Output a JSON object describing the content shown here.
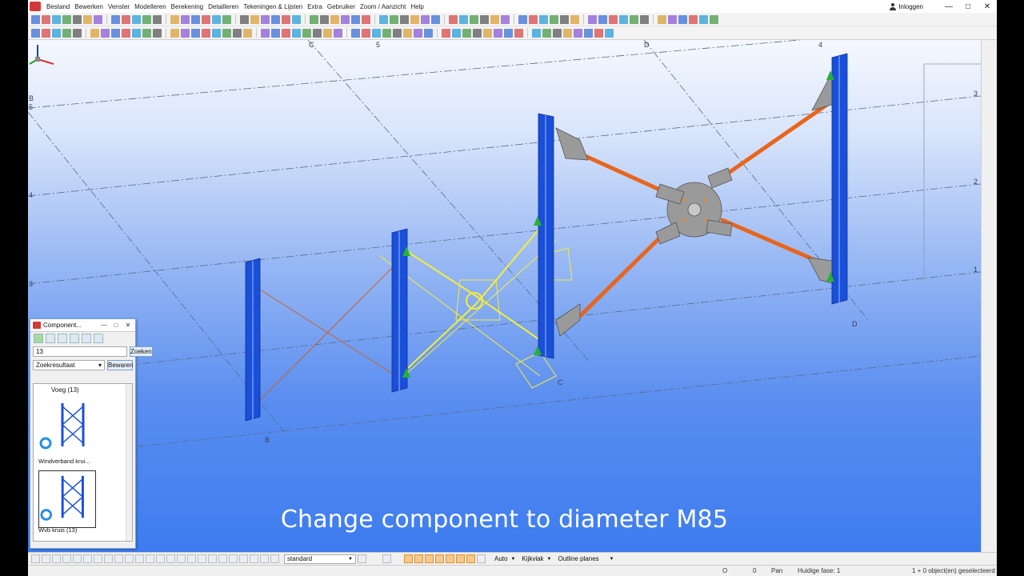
{
  "menubar": {
    "items": [
      "Bestand",
      "Bewerken",
      "Venster",
      "Modelleren",
      "Berekening",
      "Detailleren",
      "Tekeningen & Lijsten",
      "Extra",
      "Gebruiker",
      "Zoom / Aanzicht",
      "Help"
    ],
    "login": "Inloggen"
  },
  "viewport": {
    "grid_labels": [
      "C",
      "5",
      "D",
      "4",
      "B",
      "5",
      "4",
      "3",
      "3",
      "2",
      "1",
      "B",
      "C",
      "D"
    ],
    "caption": "Change component to diameter M85"
  },
  "component_panel": {
    "title": "Component...",
    "search_value": "13",
    "search_button": "Zoeken",
    "mode_select": "Zoekresultaat",
    "save_button": "Bewaren",
    "results_header": "Voeg (13)",
    "results": [
      {
        "label": "Windverband krui..."
      },
      {
        "label": "Wvb kruis (13)"
      }
    ]
  },
  "bottom_toolbar": {
    "standard_select": "standard",
    "auto_select": "Auto",
    "view_plane_select": "Kijkvlak",
    "outline_select": "Outline planes"
  },
  "statusbar": {
    "o_label": "O",
    "count": "0",
    "pan": "Pan",
    "phase": "Huidige fase: 1",
    "selection": "1 + 0 object(en) geselecteerd"
  },
  "colors": {
    "column_blue": "#1a4fd8",
    "brace_orange": "#e8651d",
    "selected_yellow": "#f3ee3a",
    "plate_grey": "#9a9a9a"
  }
}
